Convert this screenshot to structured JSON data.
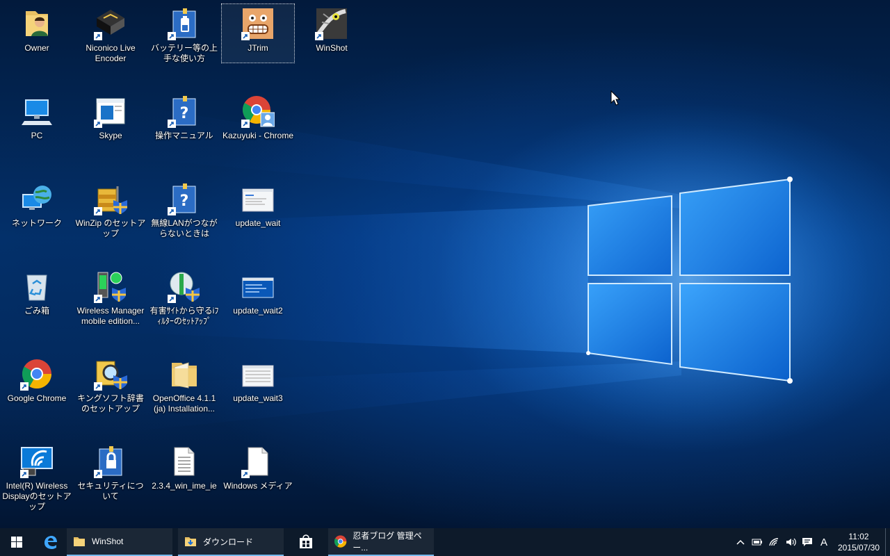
{
  "desktop": {
    "icons": [
      {
        "label": "Owner",
        "icon": "user-folder-icon"
      },
      {
        "label": "Niconico Live Encoder",
        "icon": "encoder-app-icon"
      },
      {
        "label": "バッテリー等の上手な使い方",
        "icon": "manual-book-icon"
      },
      {
        "label": "JTrim",
        "icon": "jtrim-face-icon"
      },
      {
        "label": "WinShot",
        "icon": "winshot-icon"
      },
      {
        "label": "PC",
        "icon": "computer-icon"
      },
      {
        "label": "Skype",
        "icon": "skype-window-icon"
      },
      {
        "label": "操作マニュアル",
        "icon": "help-book-icon"
      },
      {
        "label": "Kazuyuki - Chrome",
        "icon": "chrome-profile-icon"
      },
      {
        "label": "ネットワーク",
        "icon": "network-globe-icon"
      },
      {
        "label": "WinZip のセットアップ",
        "icon": "winzip-setup-icon"
      },
      {
        "label": "無線LANがつながらないときは",
        "icon": "help-book-icon"
      },
      {
        "label": "update_wait",
        "icon": "screenshot-thumb-icon"
      },
      {
        "label": "ごみ箱",
        "icon": "recycle-bin-icon"
      },
      {
        "label": "Wireless Manager mobile edition...",
        "icon": "wireless-manager-icon"
      },
      {
        "label": "有害ｻｲﾄから守るiﾌｨﾙﾀｰのｾｯﾄｱｯﾌﾟ",
        "icon": "ifilter-setup-icon"
      },
      {
        "label": "update_wait2",
        "icon": "screenshot-thumb-icon"
      },
      {
        "label": "Google Chrome",
        "icon": "chrome-icon"
      },
      {
        "label": "キングソフト辞書のセットアップ",
        "icon": "dictionary-setup-icon"
      },
      {
        "label": "OpenOffice 4.1.1 (ja) Installation...",
        "icon": "folder-icon"
      },
      {
        "label": "update_wait3",
        "icon": "screenshot-thumb-icon"
      },
      {
        "label": "Intel(R) Wireless Displayのセットアップ",
        "icon": "wireless-display-icon"
      },
      {
        "label": "セキュリティについて",
        "icon": "security-book-icon"
      },
      {
        "label": "2.3.4_win_ime_ie",
        "icon": "text-file-icon"
      },
      {
        "label": "Windows メディア",
        "icon": "blank-file-icon"
      }
    ]
  },
  "taskbar": {
    "start_icon": "windows-start-icon",
    "pinned": [
      {
        "name": "edge",
        "icon": "edge-icon"
      },
      {
        "name": "store",
        "icon": "store-icon"
      }
    ],
    "windows": [
      {
        "label": "WinShot",
        "icon": "folder-icon"
      },
      {
        "label": "ダウンロード",
        "icon": "download-folder-icon"
      },
      {
        "label": "忍者ブログ 管理ペー...",
        "icon": "chrome-icon"
      }
    ],
    "tray": {
      "ime_mode": "A",
      "time": "11:02",
      "date": "2015/07/30"
    }
  },
  "colors": {
    "taskbar_bg": "#0d1a2a",
    "accent": "#76b9ed",
    "wallpaper_blue": "#0a5cc8"
  }
}
